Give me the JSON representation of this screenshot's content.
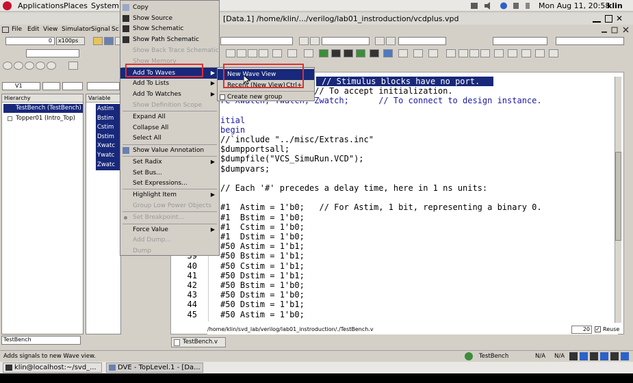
{
  "system_bar": {
    "applications": "Applications",
    "places": "Places",
    "system": "System",
    "datetime": "Mon Aug 11, 20:58",
    "user": "klin"
  },
  "window": {
    "title": "[Data.1]  /home/klin/.../verilog/lab01_instroduction/vcdplus.vpd"
  },
  "menubar": [
    "File",
    "Edit",
    "View",
    "Simulator",
    "Signal",
    "Sc"
  ],
  "toolbar": {
    "time_value": "0",
    "time_unit": "x100ps"
  },
  "left_panel": {
    "scope_value": "V1",
    "header": "Hierarchy",
    "items": [
      "TestBench (TestBench)",
      "Topper01 (Intro_Top)"
    ],
    "search_value": "TestBench"
  },
  "variable_panel": {
    "header": "Variable",
    "items": [
      "Astim",
      "Bstim",
      "Cstim",
      "Dstim",
      "Xwatc",
      "Ywatc",
      "Zwatc"
    ]
  },
  "context_menu": {
    "items": [
      {
        "label": "Copy",
        "disabled": false,
        "submenu": false
      },
      {
        "label": "Show Source",
        "disabled": false,
        "submenu": false
      },
      {
        "label": "Show Schematic",
        "disabled": false,
        "submenu": false
      },
      {
        "label": "Show Path Schematic",
        "disabled": false,
        "submenu": false
      },
      {
        "label": "Show Back Trace Schematic",
        "disabled": true,
        "submenu": false
      },
      {
        "label": "Show Memory",
        "disabled": true,
        "submenu": false
      },
      {
        "label": "Add To Waves",
        "disabled": false,
        "submenu": true,
        "highlighted": true
      },
      {
        "label": "Add To Lists",
        "disabled": false,
        "submenu": true
      },
      {
        "label": "Add To Watches",
        "disabled": false,
        "submenu": true
      },
      {
        "label": "Show Definition Scope",
        "disabled": true,
        "submenu": false
      },
      {
        "label": "Expand All",
        "disabled": false,
        "submenu": false
      },
      {
        "label": "Collapse All",
        "disabled": false,
        "submenu": false
      },
      {
        "label": "Select All",
        "disabled": false,
        "submenu": false
      },
      {
        "label": "Show Value Annotation",
        "disabled": false,
        "submenu": false
      },
      {
        "label": "Set Radix",
        "disabled": false,
        "submenu": true
      },
      {
        "label": "Set Bus...",
        "disabled": false,
        "submenu": false
      },
      {
        "label": "Set Expressions...",
        "disabled": false,
        "submenu": false
      },
      {
        "label": "Highlight Item",
        "disabled": false,
        "submenu": true
      },
      {
        "label": "Group Low Power Objects",
        "disabled": true,
        "submenu": false
      },
      {
        "label": "Set Breakpoint...",
        "disabled": true,
        "submenu": false
      },
      {
        "label": "Force Value",
        "disabled": false,
        "submenu": true
      },
      {
        "label": "Add Dump...",
        "disabled": true,
        "submenu": false
      },
      {
        "label": "Dump",
        "disabled": true,
        "submenu": false
      }
    ]
  },
  "submenu": {
    "items": [
      {
        "label": "New Wave View",
        "shortcut": ""
      },
      {
        "label": "Recent (New View)",
        "shortcut": "Ctrl+"
      },
      {
        "label": "Create new group",
        "shortcut": ""
      }
    ]
  },
  "source": {
    "header_line": "// Stimulus blocks have no port.",
    "lines": [
      {
        "no": "",
        "text": "   ..stim, Dstim;  // To accept initialization."
      },
      {
        "no": "",
        "text": "re Xwatch, Ywatch, Zwatch;      // To connect to design instance."
      },
      {
        "no": "",
        "text": ""
      },
      {
        "no": "",
        "text": "itial"
      },
      {
        "no": "",
        "text": "begin"
      },
      {
        "no": "",
        "text": "//`include \"../misc/Extras.inc\""
      },
      {
        "no": "",
        "text": "$dumpportsall;"
      },
      {
        "no": "",
        "text": "$dumpfile(\"VCS_SimuRun.VCD\");"
      },
      {
        "no": "",
        "text": "$dumpvars;"
      },
      {
        "no": "",
        "text": ""
      },
      {
        "no": "",
        "text": "// Each '#' precedes a delay time, here in 1 ns units:"
      },
      {
        "no": "",
        "text": ""
      },
      {
        "no": "",
        "text": "#1  Astim = 1'b0;   // For Astim, 1 bit, representing a binary 0."
      },
      {
        "no": "",
        "text": "#1  Bstim = 1'b0;"
      },
      {
        "no": "",
        "text": "#1  Cstim = 1'b0;"
      },
      {
        "no": "",
        "text": "#1  Dstim = 1'b0;"
      },
      {
        "no": "38",
        "text": "#50 Astim = 1'b1;"
      },
      {
        "no": "39",
        "text": "#50 Bstim = 1'b1;"
      },
      {
        "no": "40",
        "text": "#50 Cstim = 1'b1;"
      },
      {
        "no": "41",
        "text": "#50 Dstim = 1'b1;"
      },
      {
        "no": "42",
        "text": "#50 Bstim = 1'b0;"
      },
      {
        "no": "43",
        "text": "#50 Dstim = 1'b0;"
      },
      {
        "no": "44",
        "text": "#50 Dstim = 1'b1;"
      },
      {
        "no": "45",
        "text": "#50 Astim = 1'b0;"
      }
    ],
    "path": "/home/klin/svd_lab/verilog/lab01_instroduction/./TestBench.v",
    "line_value": "20",
    "reuse_label": "Reuse",
    "tab_label": "TestBench.v"
  },
  "statusbar": {
    "message": "Adds signals to new Wave view.",
    "scope": "TestBench",
    "na1": "N/A",
    "na2": "N/A"
  },
  "taskbar": {
    "task1": "klin@localhost:~/svd_...",
    "task2": "DVE - TopLevel.1 - [Da..."
  },
  "colors": {
    "menu_highlight": "#18287a",
    "annotation_red": "#e03030",
    "keyword_blue": "#1a1aa6"
  }
}
